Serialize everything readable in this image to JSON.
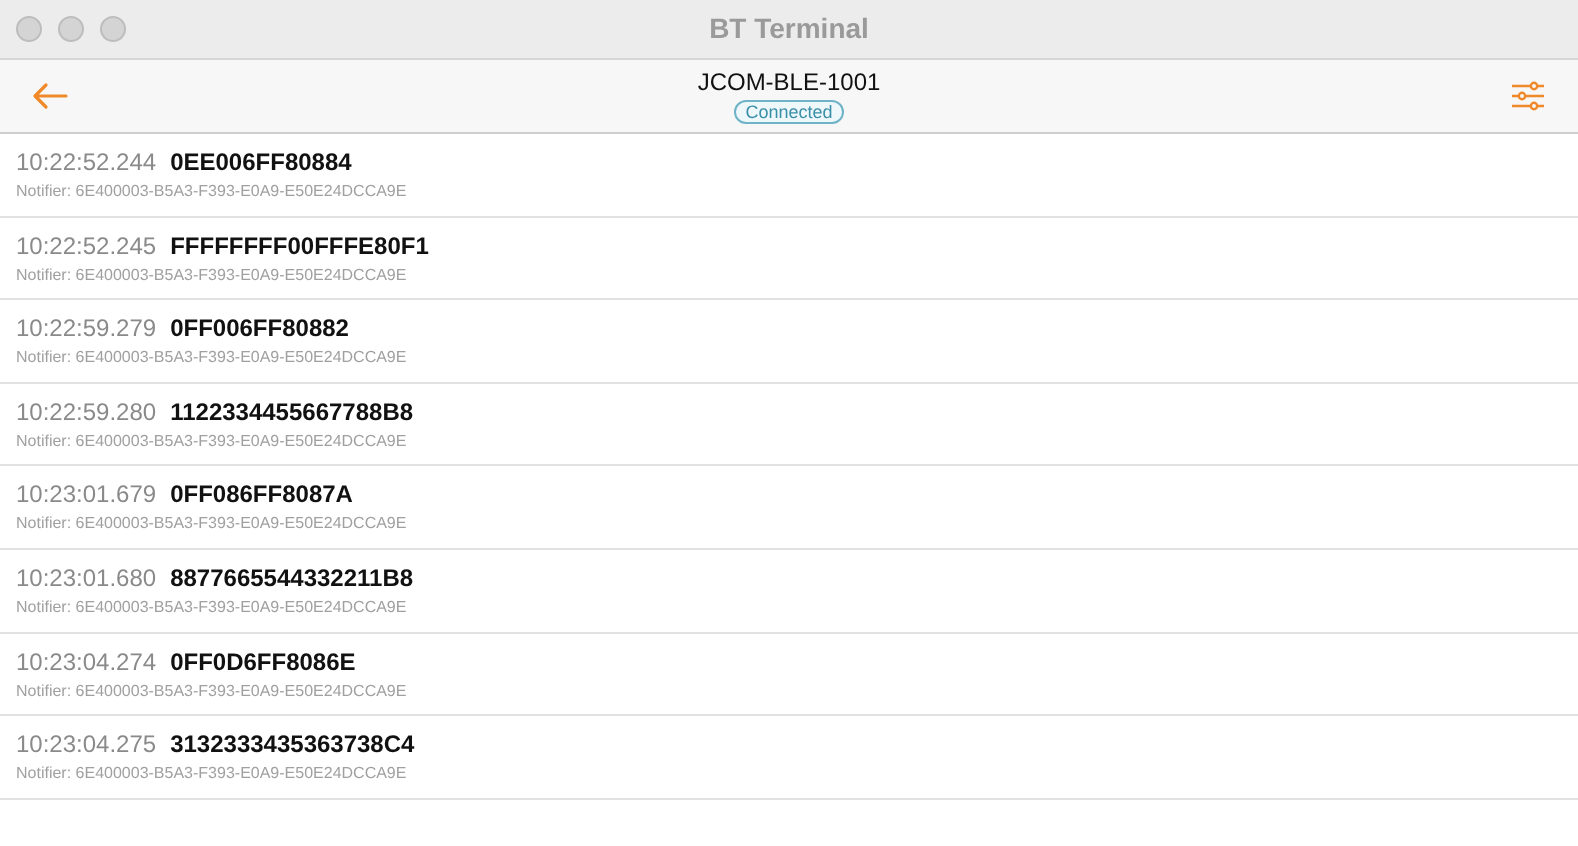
{
  "window": {
    "title": "BT Terminal"
  },
  "nav": {
    "title": "JCOM-BLE-1001",
    "status": "Connected"
  },
  "messages": [
    {
      "time": "10:22:52.244",
      "data": "0EE006FF80884",
      "source": "Notifier: 6E400003-B5A3-F393-E0A9-E50E24DCCA9E"
    },
    {
      "time": "10:22:52.245",
      "data": "FFFFFFFF00FFFE80F1",
      "source": "Notifier: 6E400003-B5A3-F393-E0A9-E50E24DCCA9E"
    },
    {
      "time": "10:22:59.279",
      "data": "0FF006FF80882",
      "source": "Notifier: 6E400003-B5A3-F393-E0A9-E50E24DCCA9E"
    },
    {
      "time": "10:22:59.280",
      "data": "1122334455667788B8",
      "source": "Notifier: 6E400003-B5A3-F393-E0A9-E50E24DCCA9E"
    },
    {
      "time": "10:23:01.679",
      "data": "0FF086FF8087A",
      "source": "Notifier: 6E400003-B5A3-F393-E0A9-E50E24DCCA9E"
    },
    {
      "time": "10:23:01.680",
      "data": "8877665544332211B8",
      "source": "Notifier: 6E400003-B5A3-F393-E0A9-E50E24DCCA9E"
    },
    {
      "time": "10:23:04.274",
      "data": "0FF0D6FF8086E",
      "source": "Notifier: 6E400003-B5A3-F393-E0A9-E50E24DCCA9E"
    },
    {
      "time": "10:23:04.275",
      "data": "3132333435363738C4",
      "source": "Notifier: 6E400003-B5A3-F393-E0A9-E50E24DCCA9E"
    }
  ]
}
